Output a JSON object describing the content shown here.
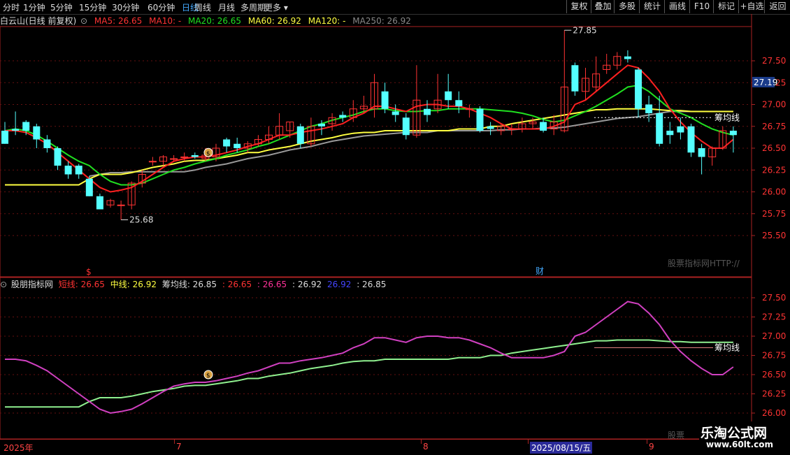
{
  "toolbar": {
    "timeframes": [
      "分时",
      "1分钟",
      "5分钟",
      "15分钟",
      "30分钟",
      "60分钟",
      "日线",
      "周线",
      "月线",
      "多周期",
      "更多"
    ],
    "active": "日线",
    "right_buttons": [
      "复权",
      "叠加",
      "多股",
      "统计",
      "画线",
      "F10",
      "标记",
      "+自选",
      "返回"
    ]
  },
  "main_info": {
    "stock": "白云山(日线 前复权)",
    "ma5": "MA5: 26.65",
    "ma10": "MA10: -",
    "ma20": "MA20: 26.65",
    "ma60": "MA60: 26.92",
    "ma120": "MA120: -",
    "ma250": "MA250: 26.92"
  },
  "ind_info": {
    "name": "股朋指标网",
    "short": "短线: 26.65",
    "mid": "中线: 26.92",
    "chip": "筹均线: 26.85",
    "v1": ": 26.65",
    "v2": ": 26.65",
    "v3": ": 26.92",
    "v4": "26.92",
    "v5": ": 26.85"
  },
  "labels": {
    "high": "27.85",
    "low": "25.68",
    "chip_label": "筹均线",
    "chip_label2": "筹均线",
    "watermark_text": "股票指标网HTTP://",
    "watermark_text2": "股票",
    "price_box": "27.19",
    "cai": "财",
    "s_marker": "$"
  },
  "dates": [
    "2025年",
    "7",
    "8",
    "2025/08/15/五",
    "9"
  ],
  "brand": {
    "name": "乐淘公式网",
    "url": "www.60lt.com"
  },
  "colors": {
    "up": "#ff3333",
    "down": "#54ffff",
    "ma5": "#ff2020",
    "ma20": "#20e020",
    "ma60": "#ffff40",
    "ma250": "#999999"
  },
  "chart_data": {
    "type": "candlestick",
    "main_axis": {
      "ticks": [
        25.5,
        25.75,
        26.0,
        26.25,
        26.5,
        26.75,
        27.0,
        27.25,
        27.5
      ]
    },
    "ind_axis": {
      "ticks": [
        26.0,
        26.25,
        26.5,
        26.75,
        27.0,
        27.25,
        27.5
      ]
    },
    "candles": [
      [
        26.7,
        26.55,
        26.8,
        26.55
      ],
      [
        26.72,
        26.7,
        26.92,
        26.65
      ],
      [
        26.8,
        26.7,
        26.82,
        26.65
      ],
      [
        26.75,
        26.6,
        26.78,
        26.5
      ],
      [
        26.6,
        26.5,
        26.65,
        26.45
      ],
      [
        26.5,
        26.3,
        26.52,
        26.25
      ],
      [
        26.3,
        26.2,
        26.35,
        26.15
      ],
      [
        26.3,
        26.2,
        26.32,
        26.15
      ],
      [
        26.15,
        25.95,
        26.18,
        25.95
      ],
      [
        25.95,
        25.8,
        25.98,
        25.8
      ],
      [
        25.85,
        25.9,
        25.92,
        25.82
      ],
      [
        25.85,
        25.85,
        25.9,
        25.68
      ],
      [
        25.85,
        26.1,
        26.12,
        25.8
      ],
      [
        26.1,
        26.2,
        26.25,
        26.05
      ],
      [
        26.35,
        26.35,
        26.4,
        26.3
      ],
      [
        26.35,
        26.4,
        26.42,
        26.3
      ],
      [
        26.38,
        26.38,
        26.42,
        26.35
      ],
      [
        26.4,
        26.4,
        26.45,
        26.35
      ],
      [
        26.42,
        26.4,
        26.45,
        26.38
      ],
      [
        26.38,
        26.42,
        26.5,
        26.35
      ],
      [
        26.4,
        26.5,
        26.55,
        26.35
      ],
      [
        26.6,
        26.52,
        26.62,
        26.45
      ],
      [
        26.55,
        26.5,
        26.62,
        26.45
      ],
      [
        26.5,
        26.55,
        26.58,
        26.45
      ],
      [
        26.55,
        26.6,
        26.65,
        26.52
      ],
      [
        26.6,
        26.65,
        26.75,
        26.55
      ],
      [
        26.65,
        26.75,
        26.9,
        26.6
      ],
      [
        26.7,
        26.8,
        26.8,
        26.62
      ],
      [
        26.75,
        26.55,
        26.78,
        26.5
      ],
      [
        26.55,
        26.75,
        26.85,
        26.52
      ],
      [
        26.78,
        26.75,
        26.82,
        26.65
      ],
      [
        26.78,
        26.85,
        26.9,
        26.7
      ],
      [
        26.88,
        26.85,
        26.92,
        26.8
      ],
      [
        26.85,
        26.95,
        27.05,
        26.8
      ],
      [
        26.95,
        26.98,
        27.1,
        26.9
      ],
      [
        26.95,
        27.25,
        27.35,
        26.85
      ],
      [
        27.15,
        26.95,
        27.25,
        26.9
      ],
      [
        26.92,
        26.88,
        27.0,
        26.8
      ],
      [
        26.85,
        26.65,
        26.9,
        26.6
      ],
      [
        26.65,
        27.05,
        27.45,
        26.62
      ],
      [
        26.95,
        26.88,
        27.05,
        26.8
      ],
      [
        26.95,
        27.05,
        27.35,
        26.9
      ],
      [
        27.15,
        27.05,
        27.35,
        26.95
      ],
      [
        27.05,
        26.98,
        27.15,
        26.9
      ],
      [
        26.95,
        26.95,
        27.0,
        26.85
      ],
      [
        26.95,
        26.7,
        26.98,
        26.68
      ],
      [
        26.75,
        26.72,
        26.8,
        26.65
      ],
      [
        26.7,
        26.75,
        26.78,
        26.65
      ],
      [
        26.72,
        26.72,
        26.78,
        26.65
      ],
      [
        26.72,
        26.78,
        26.85,
        26.68
      ],
      [
        26.78,
        26.8,
        26.85,
        26.72
      ],
      [
        26.8,
        26.7,
        26.85,
        26.68
      ],
      [
        26.72,
        26.8,
        26.88,
        26.65
      ],
      [
        26.7,
        27.2,
        27.85,
        26.68
      ],
      [
        27.45,
        27.15,
        27.48,
        27.1
      ],
      [
        27.15,
        27.3,
        27.42,
        27.05
      ],
      [
        27.2,
        27.35,
        27.55,
        27.15
      ],
      [
        27.4,
        27.45,
        27.58,
        27.35
      ],
      [
        27.45,
        27.55,
        27.6,
        27.4
      ],
      [
        27.55,
        27.52,
        27.62,
        27.48
      ],
      [
        27.4,
        26.95,
        27.42,
        26.85
      ],
      [
        27.0,
        26.9,
        27.1,
        26.8
      ],
      [
        26.9,
        26.55,
        27.1,
        26.52
      ],
      [
        26.7,
        26.65,
        26.8,
        26.55
      ],
      [
        26.75,
        26.68,
        26.85,
        26.6
      ],
      [
        26.75,
        26.45,
        26.78,
        26.4
      ],
      [
        26.5,
        26.4,
        26.55,
        26.2
      ],
      [
        26.4,
        26.5,
        26.52,
        26.3
      ],
      [
        26.5,
        26.7,
        26.75,
        26.48
      ],
      [
        26.7,
        26.65,
        26.75,
        26.45
      ]
    ],
    "ma5": [
      26.7,
      26.7,
      26.68,
      26.62,
      26.55,
      26.45,
      26.35,
      26.25,
      26.15,
      26.05,
      26.0,
      26.02,
      26.05,
      26.12,
      26.2,
      26.28,
      26.35,
      26.38,
      26.4,
      26.4,
      26.42,
      26.45,
      26.48,
      26.52,
      26.55,
      26.6,
      26.65,
      26.65,
      26.68,
      26.7,
      26.72,
      26.75,
      26.78,
      26.85,
      26.9,
      26.98,
      26.98,
      26.95,
      26.92,
      26.98,
      27.0,
      27.0,
      26.98,
      26.98,
      26.95,
      26.9,
      26.85,
      26.78,
      26.72,
      26.72,
      26.72,
      26.72,
      26.75,
      26.8,
      27.0,
      27.05,
      27.15,
      27.25,
      27.35,
      27.45,
      27.42,
      27.3,
      27.15,
      26.95,
      26.8,
      26.68,
      26.58,
      26.5,
      26.5,
      26.6
    ],
    "ma20": [
      26.7,
      26.72,
      26.7,
      26.65,
      26.58,
      26.5,
      26.42,
      26.35,
      26.3,
      26.2,
      26.12,
      26.08,
      26.08,
      26.1,
      26.15,
      26.2,
      26.25,
      26.28,
      26.32,
      26.35,
      26.38,
      26.42,
      26.45,
      26.48,
      26.52,
      26.55,
      26.6,
      26.65,
      26.7,
      26.75,
      26.78,
      26.82,
      26.85,
      26.88,
      26.92,
      26.95,
      26.95,
      26.93,
      26.92,
      26.92,
      26.93,
      26.93,
      26.95,
      26.95,
      26.95,
      26.95,
      26.94,
      26.93,
      26.92,
      26.9,
      26.87,
      26.83,
      26.8,
      26.82,
      26.87,
      26.92,
      26.98,
      27.05,
      27.12,
      27.2,
      27.22,
      27.15,
      27.05,
      26.95,
      26.9,
      26.85,
      26.78,
      26.72,
      26.68,
      26.65
    ],
    "ma60": [
      26.08,
      26.08,
      26.08,
      26.08,
      26.08,
      26.08,
      26.08,
      26.08,
      26.15,
      26.2,
      26.2,
      26.2,
      26.22,
      26.25,
      26.28,
      26.3,
      26.32,
      26.35,
      26.36,
      26.36,
      26.38,
      26.4,
      26.42,
      26.45,
      26.45,
      26.48,
      26.5,
      26.52,
      26.55,
      26.58,
      26.6,
      26.62,
      26.65,
      26.67,
      26.68,
      26.68,
      26.7,
      26.7,
      26.7,
      26.7,
      26.7,
      26.7,
      26.7,
      26.72,
      26.72,
      26.72,
      26.75,
      26.75,
      26.78,
      26.8,
      26.82,
      26.84,
      26.86,
      26.88,
      26.9,
      26.92,
      26.94,
      26.94,
      26.95,
      26.95,
      26.95,
      26.95,
      26.94,
      26.93,
      26.93,
      26.92,
      26.92,
      26.92,
      26.92,
      26.92
    ],
    "ma250": [
      null,
      null,
      null,
      null,
      null,
      null,
      null,
      null,
      26.18,
      26.2,
      26.22,
      26.22,
      26.23,
      26.23,
      26.23,
      26.23,
      26.23,
      26.23,
      26.25,
      26.28,
      26.3,
      26.32,
      26.35,
      26.38,
      26.4,
      26.42,
      26.45,
      26.48,
      26.5,
      26.52,
      26.55,
      26.58,
      26.6,
      26.62,
      26.64,
      26.65,
      26.66,
      26.67,
      26.68,
      26.68,
      26.68,
      26.7,
      26.7,
      26.7,
      26.7,
      26.7,
      26.7,
      26.71,
      26.71,
      26.72,
      26.72,
      26.73,
      26.73,
      26.74,
      26.76,
      26.78,
      26.8,
      26.82,
      26.84,
      26.85,
      26.86,
      26.88,
      26.9,
      26.92,
      26.92,
      26.92,
      26.92,
      26.92,
      26.92,
      26.92
    ]
  }
}
